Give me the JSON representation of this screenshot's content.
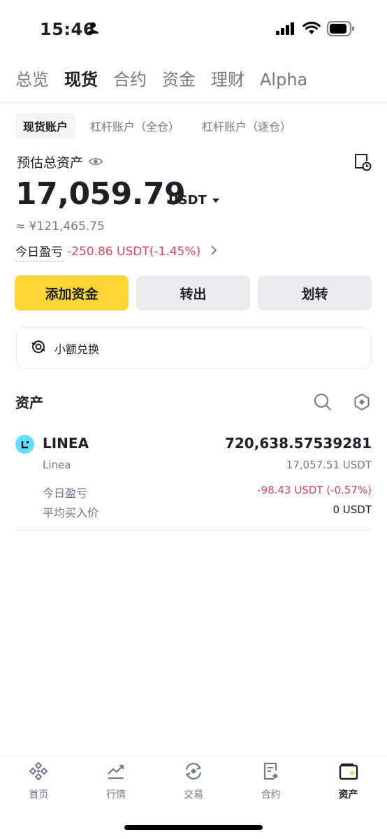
{
  "status_bar": {
    "time": "15:46"
  },
  "top_tabs": [
    {
      "label": "总览",
      "active": false
    },
    {
      "label": "现货",
      "active": true
    },
    {
      "label": "合约",
      "active": false
    },
    {
      "label": "资金",
      "active": false
    },
    {
      "label": "理财",
      "active": false
    },
    {
      "label": "Alpha",
      "active": false
    }
  ],
  "sub_tabs": [
    {
      "label": "现货账户",
      "active": true
    },
    {
      "label": "杠杆账户（全仓）",
      "active": false
    },
    {
      "label": "杠杆账户（逐仓）",
      "active": false
    }
  ],
  "balance": {
    "label": "预估总资产",
    "total": "17,059.79",
    "unit": "USDT",
    "fiat": "≈ ¥121,465.75",
    "pnl_label": "今日盈亏",
    "pnl_value": "-250.86 USDT(-1.45%)"
  },
  "actions": {
    "deposit": "添加资金",
    "withdraw": "转出",
    "transfer": "划转"
  },
  "small_convert": {
    "label": "小额兑换"
  },
  "assets": {
    "title": "资产",
    "items": [
      {
        "symbol": "LINEA",
        "name": "Linea",
        "amount": "720,638.57539281",
        "usd_value": "17,057.51 USDT",
        "pnl_label": "今日盈亏",
        "pnl_value": "-98.43 USDT (-0.57%)",
        "avg_label": "平均买入价",
        "avg_value": "0 USDT"
      }
    ]
  },
  "bottom_nav": [
    {
      "label": "首页",
      "icon": "binance-logo-icon",
      "active": false
    },
    {
      "label": "行情",
      "icon": "chart-icon",
      "active": false
    },
    {
      "label": "交易",
      "icon": "trade-icon",
      "active": false
    },
    {
      "label": "合约",
      "icon": "futures-icon",
      "active": false
    },
    {
      "label": "资产",
      "icon": "wallet-icon",
      "active": true
    }
  ],
  "colors": {
    "accent": "#fcd535",
    "negative": "#e0445a",
    "muted": "#707a8a",
    "linea": "#61dfff"
  }
}
